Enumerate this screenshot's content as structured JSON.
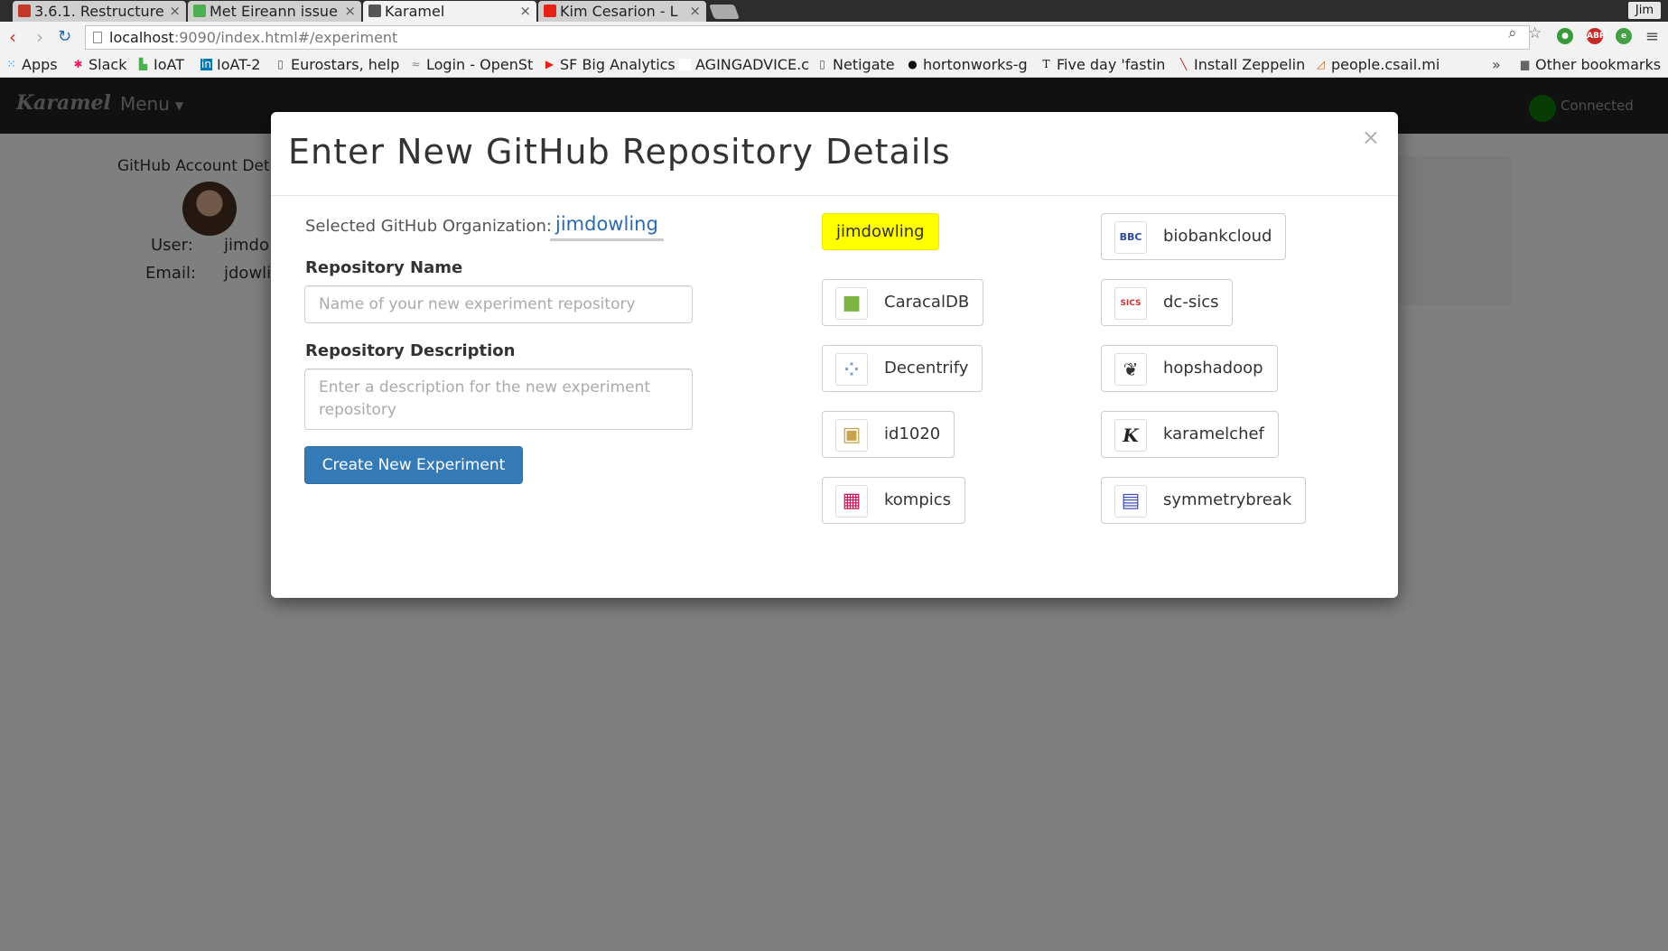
{
  "browser": {
    "tabs": [
      {
        "title": "3.6.1. Restructure",
        "favicon_color": "#c0392b"
      },
      {
        "title": "Met Eireann issue",
        "favicon_color": "#4caf50"
      },
      {
        "title": "Karamel",
        "favicon_color": "#555555"
      },
      {
        "title": "Kim Cesarion - L",
        "favicon_color": "#e62117"
      }
    ],
    "profile_name": "Jim",
    "url_host": "localhost",
    "url_rest": ":9090/index.html#/experiment",
    "bookmarks": [
      {
        "label": "Apps",
        "icon": "apps-grid-icon"
      },
      {
        "label": "Slack",
        "icon": "slack-icon"
      },
      {
        "label": "IoAT",
        "icon": "ioat-icon"
      },
      {
        "label": "IoAT-2",
        "icon": "linkedin-icon"
      },
      {
        "label": "Eurostars, help",
        "icon": "page-icon"
      },
      {
        "label": "Login - OpenSt",
        "icon": "openstack-icon"
      },
      {
        "label": "SF Big Analytics",
        "icon": "youtube-icon"
      },
      {
        "label": "AGINGADVICE.c",
        "icon": "blank-icon"
      },
      {
        "label": "Netigate",
        "icon": "page-icon"
      },
      {
        "label": "hortonworks-g",
        "icon": "github-icon"
      },
      {
        "label": "Five day 'fastin",
        "icon": "nyt-icon"
      },
      {
        "label": "Install Zeppelin",
        "icon": "zeppelin-icon"
      },
      {
        "label": "people.csail.mi",
        "icon": "csail-icon"
      }
    ],
    "more_bookmarks": "»",
    "other_bookmarks": "Other bookmarks"
  },
  "app": {
    "brand": "Karamel",
    "menu_label": "Menu",
    "connection_status": "Connected",
    "background": {
      "panel_title": "GitHub Account Det",
      "user_label": "User:",
      "user_value": "jimdo",
      "email_label": "Email:",
      "email_value": "jdowli"
    }
  },
  "modal": {
    "title": "Enter New GitHub Repository Details",
    "close": "×",
    "selected_org_label": "Selected GitHub Organization:",
    "selected_org_value": "jimdowling",
    "repo_name_label": "Repository Name",
    "repo_name_placeholder": "Name of your new experiment repository",
    "repo_name_value": "",
    "repo_desc_label": "Repository Description",
    "repo_desc_placeholder": "Enter a description for the new experiment repository",
    "repo_desc_value": "",
    "create_button": "Create New Experiment",
    "organizations": [
      {
        "name": "jimdowling",
        "logo": "",
        "selected": true
      },
      {
        "name": "biobankcloud",
        "logo": "BBC",
        "logo_color": "#2b4a9e"
      },
      {
        "name": "CaracalDB",
        "logo": "■",
        "logo_color": "#7cb342"
      },
      {
        "name": "dc-sics",
        "logo": "SICS",
        "logo_color": "#d32f2f"
      },
      {
        "name": "Decentrify",
        "logo": "⁘",
        "logo_color": "#7aa0c0"
      },
      {
        "name": "hopshadoop",
        "logo": "❦",
        "logo_color": "#333333"
      },
      {
        "name": "id1020",
        "logo": "▣",
        "logo_color": "#c9a24a"
      },
      {
        "name": "karamelchef",
        "logo": "K",
        "logo_color": "#222222"
      },
      {
        "name": "kompics",
        "logo": "▦",
        "logo_color": "#c2185b"
      },
      {
        "name": "symmetrybreak",
        "logo": "▤",
        "logo_color": "#3f51b5"
      }
    ]
  },
  "colors": {
    "selected_org_bg": "#ffff00",
    "primary_button": "#337ab7",
    "link": "#2a6bb0",
    "connected": "#0b7a0b"
  }
}
